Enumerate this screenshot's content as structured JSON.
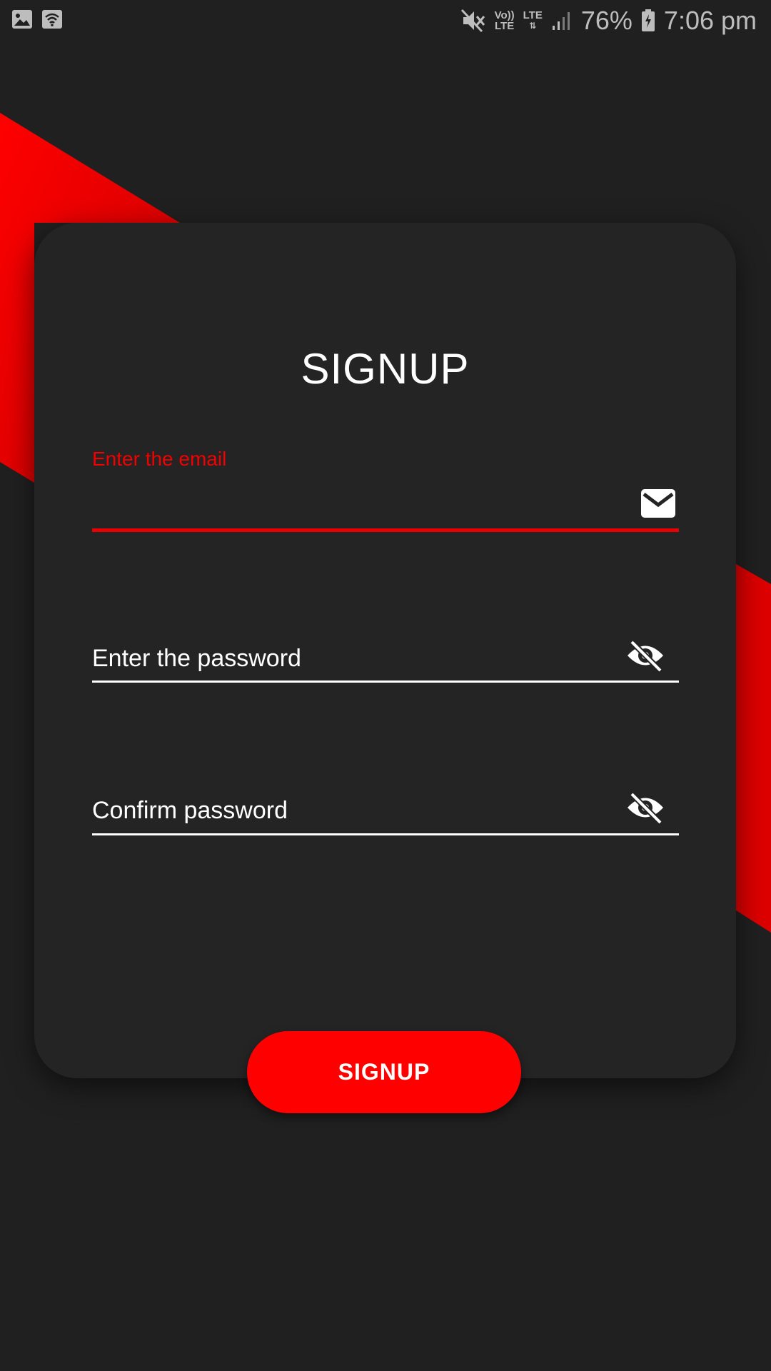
{
  "status_bar": {
    "left_icons": [
      "image-icon",
      "wifi-icon"
    ],
    "right_icons": [
      "mute-icon",
      "signal-icon",
      "battery-icon"
    ],
    "volte_label": "Vo))",
    "volte_sub": "LTE",
    "lte_label": "LTE",
    "battery": "76%",
    "time": "7:06 pm"
  },
  "form": {
    "title": "SIGNUP",
    "email": {
      "label": "Enter the email",
      "value": "",
      "icon": "mail-icon"
    },
    "password": {
      "placeholder": "Enter the password",
      "value": "",
      "icon": "eye-off-icon"
    },
    "confirm": {
      "placeholder": "Confirm password",
      "value": "",
      "icon": "eye-off-icon"
    },
    "submit_label": "SIGNUP"
  },
  "colors": {
    "accent": "#ff0000",
    "background": "#202020",
    "card": "#242424",
    "text": "#ffffff"
  }
}
